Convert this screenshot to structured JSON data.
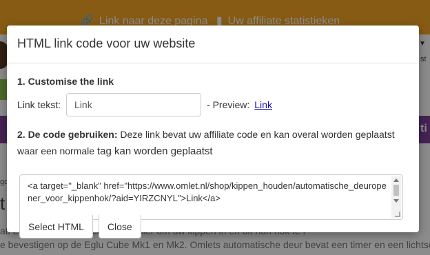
{
  "background": {
    "topbar_links": [
      "Link naar deze pagina",
      "Uw affiliate statistieken"
    ],
    "right_edge_text": "st",
    "right_purple_char": "ti",
    "small_text": "go",
    "heading_fragment": "t",
    "body_line_1": "ati                     e eenvoudige en veiligste manier om uw kippen in en uit hun hok te l",
    "body_line_2": "e bevestigen op de Eglu Cube Mk1 en Mk2. Omlets automatische deur bevat een timer en een lichtse"
  },
  "modal": {
    "title": "HTML link code voor uw website",
    "section1_title": "1. Customise the link",
    "link_text_label": "Link tekst:",
    "link_text_value": "Link",
    "preview_label": "- Preview:",
    "preview_link": "Link",
    "section2_title": "2. De code gebruiken:",
    "section2_text": " Deze link bevat uw affiliate code en kan overal worden geplaatst waar een normale ",
    "section2_text_tail": "tag kan worden geplaatst",
    "code": "<a target=\"_blank\" href=\"https://www.omlet.nl/shop/kippen_houden/automatische_deuropener_voor_kippenhok/?aid=YIRZCNYL\">Link</a>",
    "select_button": "Select HTML",
    "close_button": "Close"
  },
  "colors": {
    "topbar": "#f5a623",
    "green_band": "#8bc34a",
    "purple_band": "#7e3f98",
    "link": "#1a0dab"
  }
}
